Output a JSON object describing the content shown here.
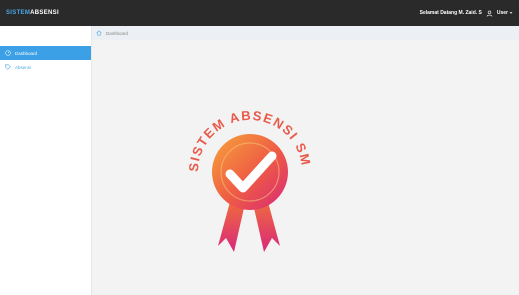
{
  "header": {
    "brand_prefix": "SISTEM",
    "brand_suffix": "ABSENSI",
    "welcome": "Selamat Datang M. Zaid. S",
    "user_menu": "User"
  },
  "sidebar": {
    "items": [
      {
        "label": "Dashboard",
        "icon": "dashboard-icon",
        "active": true
      },
      {
        "label": "Absensi",
        "icon": "tag-icon",
        "active": false
      }
    ]
  },
  "breadcrumb": {
    "label": "Dashboard",
    "icon": "home-icon"
  },
  "logo": {
    "arc_text": "SISTEM ABSENSI SMK"
  },
  "colors": {
    "accent": "#3ba0e6",
    "topbar": "#2a2a2a",
    "badge_orange": "#f29a3a",
    "badge_pink": "#e0336e"
  }
}
